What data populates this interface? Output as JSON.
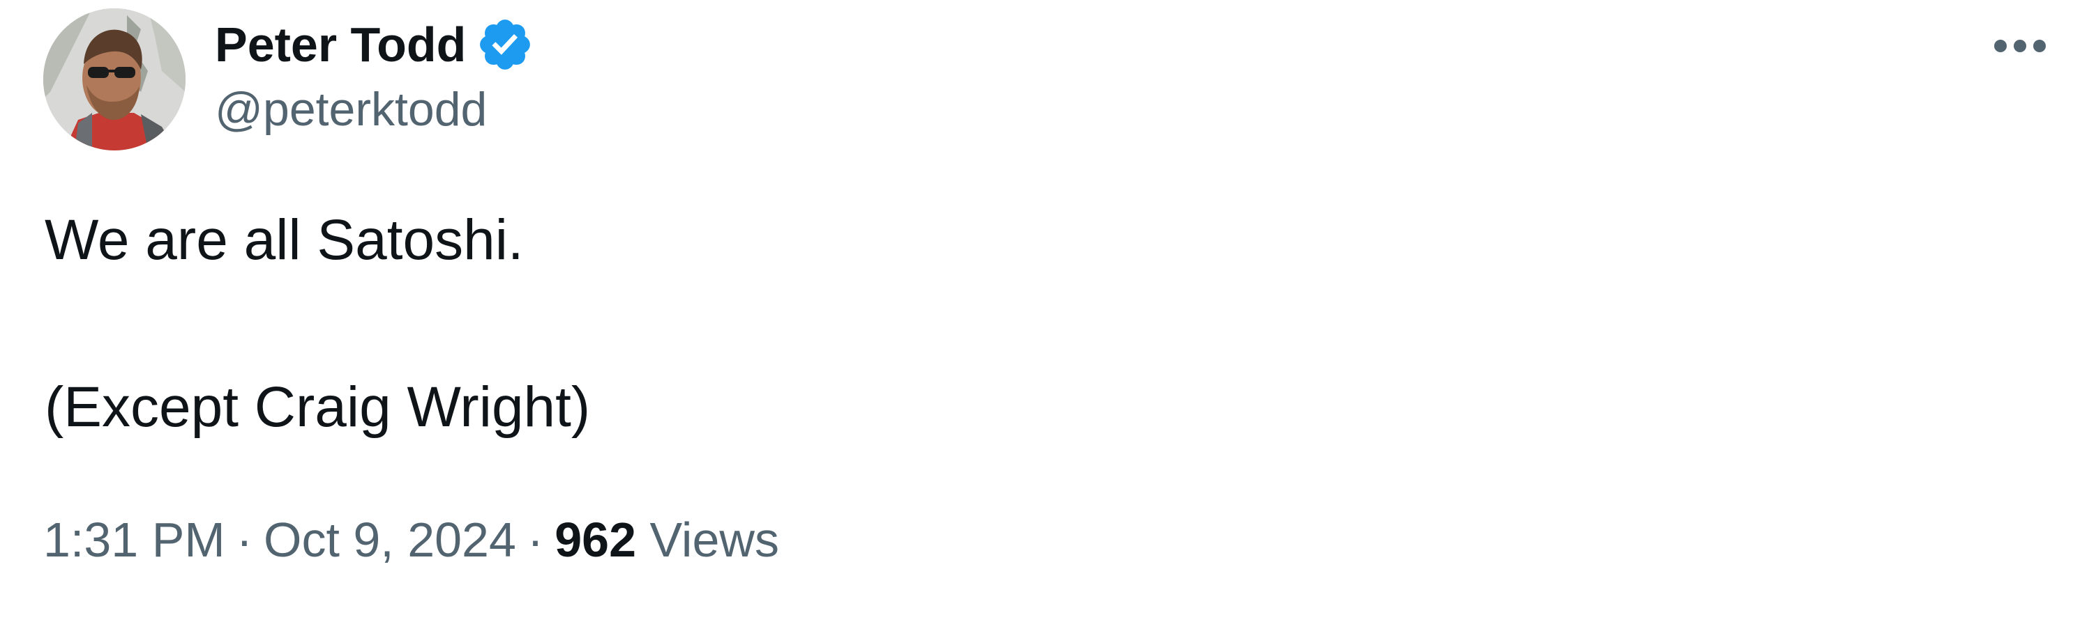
{
  "author": {
    "display_name": "Peter Todd",
    "handle": "@peterktodd",
    "avatar_icon": "avatar-photo",
    "verified_icon": "verified-badge-icon",
    "verified_color": "#1d9bf0"
  },
  "tweet": {
    "lines": [
      "We are all Satoshi.",
      "(Except Craig Wright)"
    ],
    "time": "1:31 PM",
    "date": "Oct 9, 2024",
    "separator": "·",
    "views_count": "962",
    "views_label": "Views"
  },
  "menu": {
    "more_icon": "more-horizontal-icon"
  },
  "colors": {
    "text_primary": "#0f1419",
    "text_secondary": "#536471",
    "background": "#ffffff"
  }
}
